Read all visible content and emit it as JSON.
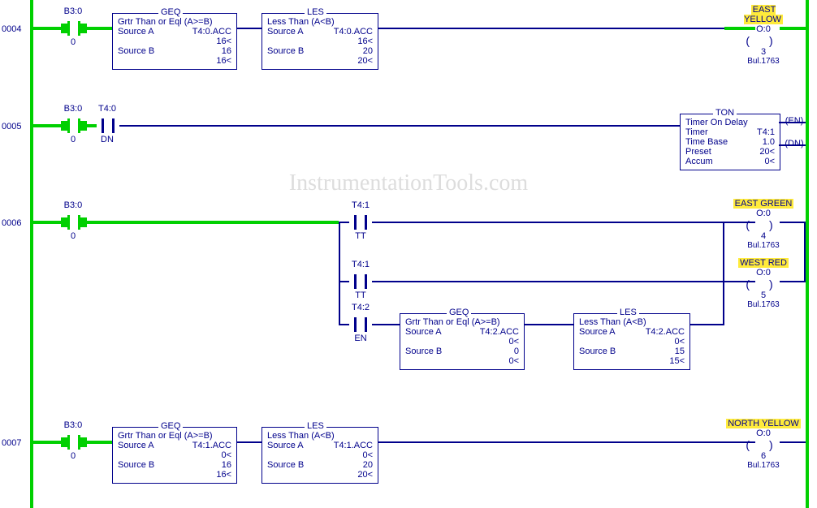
{
  "watermark": "InstrumentationTools.com",
  "rungs": {
    "r0004": {
      "num": "0004",
      "contact": {
        "addr": "B3:0",
        "bit": "0"
      },
      "geq": {
        "label": "GEQ",
        "title": "Grtr Than or Eql (A>=B)",
        "sa_l": "Source A",
        "sa_v": "T4:0.ACC",
        "sa_val": "16<",
        "sb_l": "Source B",
        "sb_v": "16",
        "sb_val": "16<"
      },
      "les": {
        "label": "LES",
        "title": "Less Than (A<B)",
        "sa_l": "Source A",
        "sa_v": "T4:0.ACC",
        "sa_val": "16<",
        "sb_l": "Source B",
        "sb_v": "20",
        "sb_val": "20<"
      },
      "out": {
        "name": "EAST YELLOW",
        "addr": "O:0",
        "bit": "3",
        "mod": "Bul.1763"
      }
    },
    "r0005": {
      "num": "0005",
      "c1": {
        "addr": "B3:0",
        "bit": "0"
      },
      "c2": {
        "addr": "T4:0",
        "bit": "DN"
      },
      "ton": {
        "label": "TON",
        "title": "Timer On Delay",
        "l1": "Timer",
        "v1": "T4:1",
        "l2": "Time Base",
        "v2": "1.0",
        "l3": "Preset",
        "v3": "20<",
        "l4": "Accum",
        "v4": "0<",
        "en": "EN",
        "dn": "DN"
      }
    },
    "r0006": {
      "num": "0006",
      "c1": {
        "addr": "B3:0",
        "bit": "0"
      },
      "c2a": {
        "addr": "T4:1",
        "bit": "TT"
      },
      "c2b": {
        "addr": "T4:1",
        "bit": "TT"
      },
      "c3": {
        "addr": "T4:2",
        "bit": "EN"
      },
      "geq": {
        "label": "GEQ",
        "title": "Grtr Than or Eql (A>=B)",
        "sa_l": "Source A",
        "sa_v": "T4:2.ACC",
        "sa_val": "0<",
        "sb_l": "Source B",
        "sb_v": "0",
        "sb_val": "0<"
      },
      "les": {
        "label": "LES",
        "title": "Less Than (A<B)",
        "sa_l": "Source A",
        "sa_v": "T4:2.ACC",
        "sa_val": "0<",
        "sb_l": "Source B",
        "sb_v": "15",
        "sb_val": "15<"
      },
      "out1": {
        "name": "EAST GREEN",
        "addr": "O:0",
        "bit": "4",
        "mod": "Bul.1763"
      },
      "out2": {
        "name": "WEST RED",
        "addr": "O:0",
        "bit": "5",
        "mod": "Bul.1763"
      }
    },
    "r0007": {
      "num": "0007",
      "c1": {
        "addr": "B3:0",
        "bit": "0"
      },
      "geq": {
        "label": "GEQ",
        "title": "Grtr Than or Eql (A>=B)",
        "sa_l": "Source A",
        "sa_v": "T4:1.ACC",
        "sa_val": "0<",
        "sb_l": "Source B",
        "sb_v": "16",
        "sb_val": "16<"
      },
      "les": {
        "label": "LES",
        "title": "Less Than (A<B)",
        "sa_l": "Source A",
        "sa_v": "T4:1.ACC",
        "sa_val": "0<",
        "sb_l": "Source B",
        "sb_v": "20",
        "sb_val": "20<"
      },
      "out": {
        "name": "NORTH YELLOW",
        "addr": "O:0",
        "bit": "6",
        "mod": "Bul.1763"
      }
    }
  }
}
